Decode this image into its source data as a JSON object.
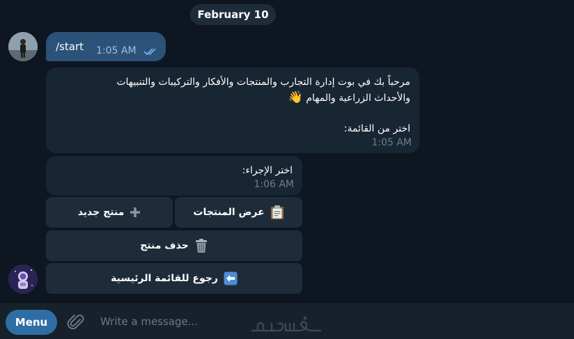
{
  "chat": {
    "date_separator": "February 10",
    "outgoing": {
      "text": "/start",
      "time": "1:05 AM"
    },
    "welcome": {
      "line1": "مرحباً بك في بوت إدارة التجارب والمنتجات والأفكار والتركيبات والتنبيهات",
      "line2": "والأحداث الزراعية والمهام",
      "line2_emoji": "👋",
      "line3": "اختر من القائمة:",
      "time": "1:05 AM"
    },
    "action_prompt": {
      "text": "اختر الإجراء:",
      "time": "1:06 AM"
    },
    "keyboard": {
      "view_products": "عرض المنتجات",
      "new_product": "منتج جديد",
      "delete_product": "حذف منتج",
      "back_main_menu": "رجوع للقائمة الرئيسية"
    }
  },
  "composer": {
    "menu_label": "Menu",
    "placeholder": "Write a message..."
  },
  "colors": {
    "background": "#0e1621",
    "incoming_bubble": "#182533",
    "outgoing_bubble": "#2b5278",
    "accent": "#2f6ea5"
  },
  "icons": [
    "double-check-icon",
    "clipboard-icon",
    "plus-icon",
    "trash-icon",
    "back-arrow-icon",
    "paperclip-icon",
    "waving-hand-emoji"
  ]
}
